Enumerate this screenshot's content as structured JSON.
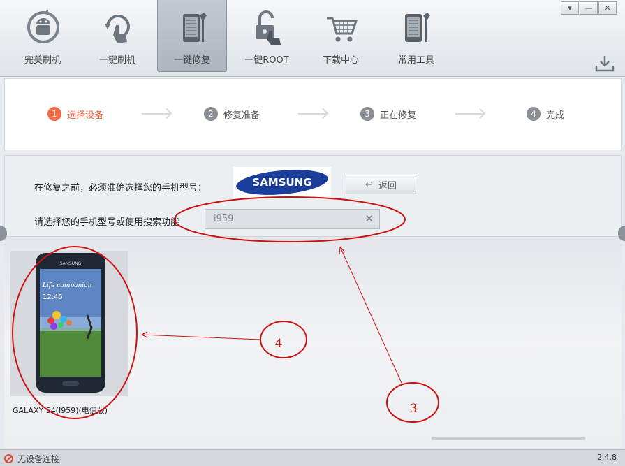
{
  "toolbar": {
    "items": [
      {
        "label": "完美刷机",
        "icon": "android-refresh-icon"
      },
      {
        "label": "一键刷机",
        "icon": "touch-refresh-icon"
      },
      {
        "label": "一键修复",
        "icon": "phone-wrench-icon"
      },
      {
        "label": "一键ROOT",
        "icon": "unlock-touch-icon"
      },
      {
        "label": "下载中心",
        "icon": "shopping-cart-icon"
      },
      {
        "label": "常用工具",
        "icon": "phone-tools-icon"
      }
    ],
    "active_index": 2,
    "window_buttons": {
      "menu": "▾",
      "minimize": "—",
      "close": "✕"
    }
  },
  "steps": [
    {
      "number": "1",
      "label": "选择设备",
      "active": true
    },
    {
      "number": "2",
      "label": "修复准备",
      "active": false
    },
    {
      "number": "3",
      "label": "正在修复",
      "active": false
    },
    {
      "number": "4",
      "label": "完成",
      "active": false
    }
  ],
  "selection": {
    "prompt_model": "在修复之前，必须准确选择您的手机型号：",
    "brand_logo": "SAMSUNG",
    "back_button": "返回",
    "prompt_search": "请选择您的手机型号或使用搜索功能",
    "search_value": "i959",
    "clear_symbol": "✕"
  },
  "devices": [
    {
      "name": "GALAXY S4(I959)(电信版)",
      "screen_text_1": "Life companion",
      "screen_text_2": "12:45",
      "phone_brand": "SAMSUNG"
    }
  ],
  "status": {
    "text": "无设备连接",
    "version": "2.4.8"
  },
  "annotations": {
    "label_3": "3",
    "label_4": "4"
  },
  "colors": {
    "accent": "#ef6a47",
    "annotation": "#cc1111",
    "samsung_blue": "#1b3d9b"
  }
}
